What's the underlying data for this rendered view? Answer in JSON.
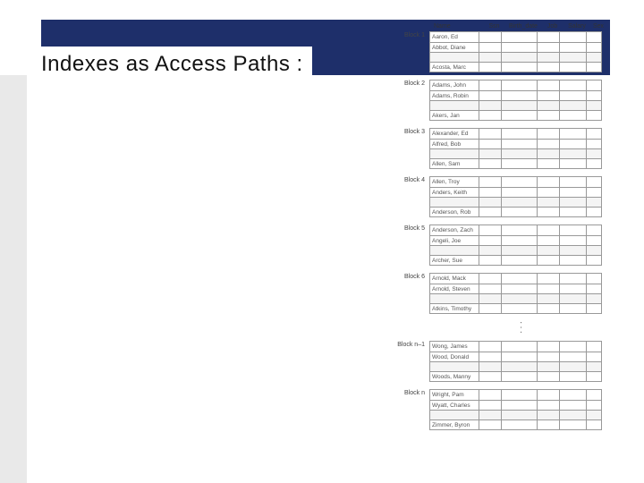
{
  "title": "Indexes as Access Paths :",
  "columns": [
    "Name",
    "Ssn",
    "Birth_date",
    "Job",
    "Salary",
    "Sex"
  ],
  "blocks": [
    {
      "label": "Block 1",
      "rows_top": [
        "Aaron, Ed",
        "Abbot, Diane"
      ],
      "rows_bottom": [
        "Acosta, Marc"
      ]
    },
    {
      "label": "Block 2",
      "rows_top": [
        "Adams, John",
        "Adams, Robin"
      ],
      "rows_bottom": [
        "Akers, Jan"
      ]
    },
    {
      "label": "Block 3",
      "rows_top": [
        "Alexander, Ed",
        "Alfred, Bob"
      ],
      "rows_bottom": [
        "Allen, Sam"
      ]
    },
    {
      "label": "Block 4",
      "rows_top": [
        "Allen, Troy",
        "Anders, Keith"
      ],
      "rows_bottom": [
        "Anderson, Rob"
      ]
    },
    {
      "label": "Block 5",
      "rows_top": [
        "Anderson, Zach",
        "Angeli, Joe"
      ],
      "rows_bottom": [
        "Archer, Sue"
      ]
    },
    {
      "label": "Block 6",
      "rows_top": [
        "Arnold, Mack",
        "Arnold, Steven"
      ],
      "rows_bottom": [
        "Atkins, Timothy"
      ]
    },
    {
      "label": "Block n–1",
      "rows_top": [
        "Wong, James",
        "Wood, Donald"
      ],
      "rows_bottom": [
        "Woods, Manny"
      ]
    },
    {
      "label": "Block n",
      "rows_top": [
        "Wright, Pam",
        "Wyatt, Charles"
      ],
      "rows_bottom": [
        "Zimmer, Byron"
      ]
    }
  ]
}
